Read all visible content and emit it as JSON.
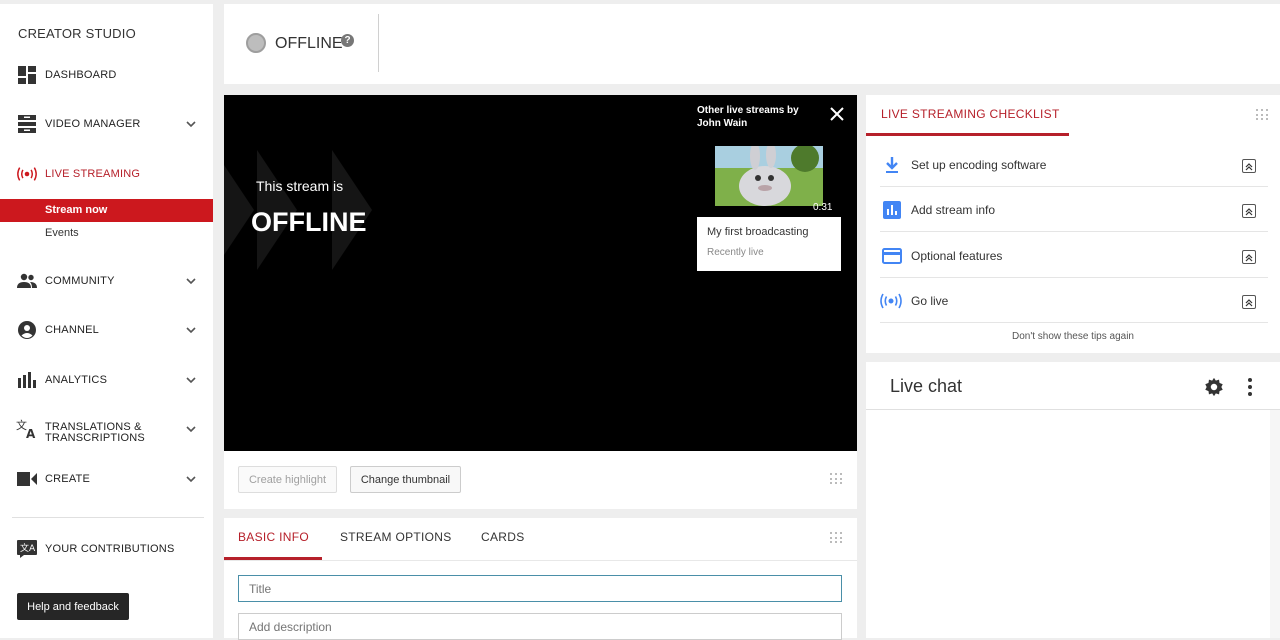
{
  "sidebar": {
    "brand": "CREATOR STUDIO",
    "items": [
      {
        "label": "DASHBOARD"
      },
      {
        "label": "VIDEO MANAGER"
      },
      {
        "label": "LIVE STREAMING"
      },
      {
        "label": "COMMUNITY"
      },
      {
        "label": "CHANNEL"
      },
      {
        "label": "ANALYTICS"
      },
      {
        "label": "TRANSLATIONS &",
        "label2": "TRANSCRIPTIONS"
      },
      {
        "label": "CREATE"
      },
      {
        "label": "YOUR CONTRIBUTIONS"
      }
    ],
    "sub_items": [
      "Stream now",
      "Events"
    ],
    "help_label": "Help and feedback",
    "active_color": "#cc181e"
  },
  "status": {
    "text": "OFFLINE",
    "help_glyph": "?"
  },
  "player": {
    "line1": "This stream is",
    "line2": "OFFLINE",
    "other_streams": "Other live streams by John Wain",
    "thumb_duration": "0:31",
    "card_title": "My first broadcasting",
    "card_subtitle": "Recently live",
    "create_highlight": "Create highlight",
    "change_thumbnail": "Change thumbnail"
  },
  "info": {
    "tabs": [
      "BASIC INFO",
      "STREAM OPTIONS",
      "CARDS"
    ],
    "title_placeholder": "Title",
    "description_placeholder": "Add description"
  },
  "checklist": {
    "title": "LIVE STREAMING CHECKLIST",
    "items": [
      {
        "label": "Set up encoding software",
        "icon": "download-icon"
      },
      {
        "label": "Add stream info",
        "icon": "stats-icon"
      },
      {
        "label": "Optional features",
        "icon": "card-icon"
      },
      {
        "label": "Go live",
        "icon": "live-icon"
      }
    ],
    "dont_show": "Don't show these tips again",
    "accent": "#b6202a",
    "icon_color": "#4285f4"
  },
  "chat": {
    "title": "Live chat"
  }
}
